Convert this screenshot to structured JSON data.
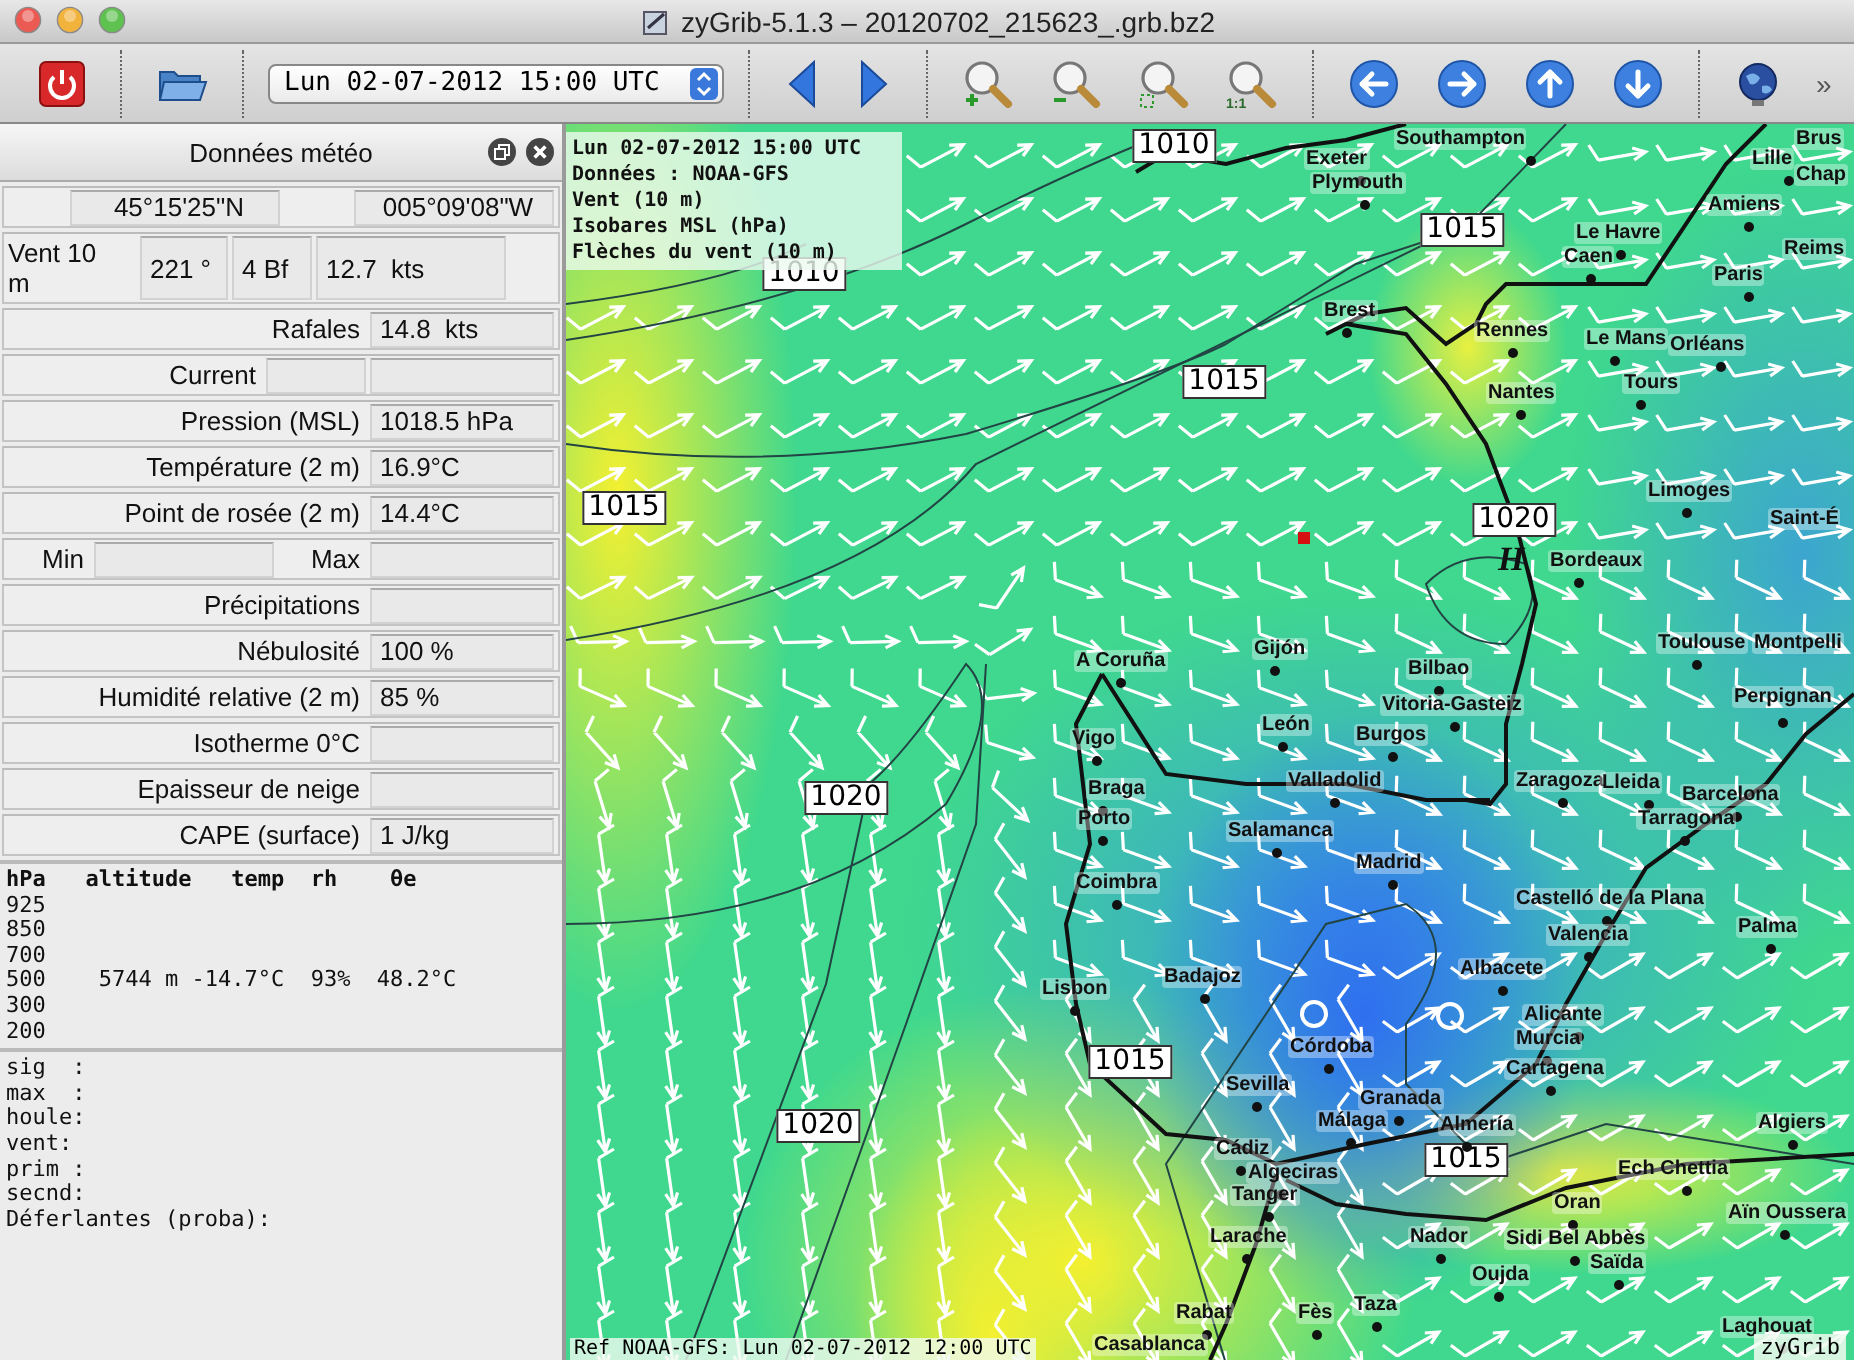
{
  "window": {
    "title": "zyGrib-5.1.3 – 20120702_215623_.grb.bz2"
  },
  "toolbar": {
    "date_select": {
      "value": "Lun 02-07-2012 15:00 UTC"
    },
    "zoom_reset_label": "1:1",
    "overflow": "»"
  },
  "panel": {
    "title": "Données météo",
    "coordinates": [
      "45°15'25\"N",
      "005°09'08\"W"
    ],
    "wind": {
      "label": "Vent 10 m",
      "values": [
        "221 °",
        "4 Bf",
        "12.7  kts"
      ]
    },
    "rows": [
      {
        "kind": "field",
        "label": "Rafales",
        "value": "14.8  kts"
      },
      {
        "kind": "current",
        "label": "Current"
      },
      {
        "kind": "field",
        "label": "Pression (MSL)",
        "value": "1018.5 hPa"
      },
      {
        "kind": "field",
        "label": "Température (2 m)",
        "value": "16.9°C"
      },
      {
        "kind": "field",
        "label": "Point de rosée (2 m)",
        "value": "14.4°C"
      },
      {
        "kind": "minmax",
        "labels": [
          "Min",
          "Max"
        ]
      },
      {
        "kind": "field",
        "label": "Précipitations"
      },
      {
        "kind": "field",
        "label": "Nébulosité",
        "value": "100 %"
      },
      {
        "kind": "field",
        "label": "Humidité relative (2 m)",
        "value": "85 %"
      },
      {
        "kind": "field",
        "label": "Isotherme 0°C"
      },
      {
        "kind": "field",
        "label": "Epaisseur de neige"
      },
      {
        "kind": "field",
        "label": "CAPE (surface)",
        "value": "1 J/kg"
      }
    ],
    "altitude_table": {
      "header": "hPa   altitude   temp  rh    θe",
      "rows": [
        "925",
        "850",
        "700",
        "500    5744 m -14.7°C  93%  48.2°C",
        "300",
        "200"
      ]
    },
    "sea_state": [
      "sig  :",
      "max  :",
      "houle:",
      "vent:",
      "prim :",
      "secnd:",
      "Déferlantes (proba):"
    ]
  },
  "map": {
    "info_lines": [
      "Lun 02-07-2012 15:00 UTC",
      "Données : NOAA-GFS",
      "Vent (10 m)",
      "Isobares MSL (hPa)",
      "Flèches du vent (10 m)"
    ],
    "isobar_labels": [
      "1010",
      "1010",
      "1015",
      "1015",
      "1015",
      "1020",
      "1020",
      "1020",
      "1015",
      "1015"
    ],
    "pressure_centers": [
      {
        "label": "H"
      }
    ],
    "cities": [
      "Southampton",
      "Brus",
      "Exeter",
      "Lille",
      "Chap",
      "Plymouth",
      "Amiens",
      "Le Havre",
      "Reims",
      "Caen",
      "Paris",
      "Brest",
      "Rennes",
      "Le Mans",
      "Orléans",
      "Tours",
      "Nantes",
      "Limoges",
      "Saint-É",
      "Bordeaux",
      "Toulouse",
      "Montpelli",
      "A Coruña",
      "Gijón",
      "Bilbao",
      "Vitoria-Gasteiz",
      "Perpignan",
      "León",
      "Burgos",
      "Vigo",
      "Valladolid",
      "Zaragoza",
      "Lleida",
      "Braga",
      "Barcelona",
      "Porto",
      "Tarragona",
      "Salamanca",
      "Madrid",
      "Coimbra",
      "Castelló de la Plana",
      "Palma",
      "Valencia",
      "Albacete",
      "Badajoz",
      "Lisbon",
      "Alicante",
      "Murcia",
      "Córdoba",
      "Cartagena",
      "Sevilla",
      "Granada",
      "Málaga",
      "Almería",
      "Algiers",
      "Cádiz",
      "Ech Chettia",
      "Algeciras",
      "Tanger",
      "Oran",
      "Aïn Oussera",
      "Larache",
      "Nador",
      "Sidi Bel Abbès",
      "Saïda",
      "Oujda",
      "Taza",
      "Rabat",
      "Fès",
      "Laghouat",
      "Casablanca"
    ],
    "reference": "Ref NOAA-GFS: Lun 02-07-2012 12:00 UTC",
    "brand": "zyGrib"
  }
}
